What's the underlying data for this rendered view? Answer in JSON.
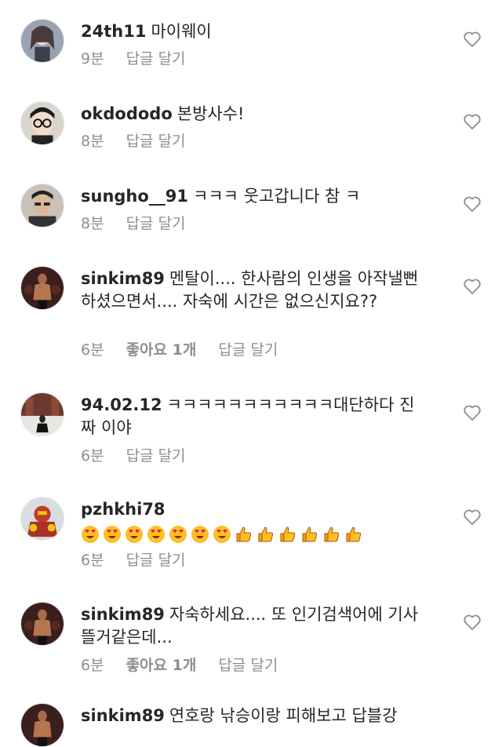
{
  "colors": {
    "text": "#262626",
    "meta": "#8e8e8e",
    "heart": "#8e8e8e"
  },
  "labels": {
    "reply": "답글 달기",
    "likes_prefix": "좋아요",
    "likes_suffix": "개"
  },
  "comments": [
    {
      "username": "24th11",
      "text": "마이웨이",
      "time": "9분",
      "likes": "",
      "avatar": "anime-girl-avatar"
    },
    {
      "username": "okdododo",
      "text": "본방사수!",
      "time": "8분",
      "likes": "",
      "avatar": "glasses-person-avatar"
    },
    {
      "username": "sungho__91",
      "text": "ㅋㅋㅋ 웃고갑니다 참 ㅋ",
      "time": "8분",
      "likes": "",
      "avatar": "man-avatar"
    },
    {
      "username": "sinkim89",
      "text": "멘탈이.... 한사람의 인생을 아작낼뻔하셨으면서.... 자숙에 시간은 없으신지요??",
      "time": "6분",
      "likes": "좋아요 1개",
      "avatar": "bodybuilder-avatar"
    },
    {
      "username": "94.02.12",
      "text": "ㅋㅋㅋㅋㅋㅋㅋㅋㅋㅋㅋ대단하다 진짜 이야",
      "time": "6분",
      "likes": "",
      "avatar": "winter-street-avatar"
    },
    {
      "username": "pzhkhi78",
      "text": "",
      "time": "6분",
      "likes": "",
      "avatar": "hulkbuster-avatar",
      "emojis": [
        "heart-eyes",
        "heart-eyes",
        "heart-eyes",
        "heart-eyes",
        "heart-eyes",
        "heart-eyes",
        "heart-eyes",
        "thumbs-up",
        "thumbs-up",
        "thumbs-up",
        "thumbs-up",
        "thumbs-up",
        "thumbs-up"
      ]
    },
    {
      "username": "sinkim89",
      "text": "자숙하세요.... 또 인기검색어에 기사뜰거같은데...",
      "time": "6분",
      "likes": "좋아요 1개",
      "avatar": "bodybuilder-avatar"
    },
    {
      "username": "sinkim89",
      "text": "연호랑 낚승이랑 피해보고 답블강",
      "time": "",
      "likes": "",
      "avatar": "bodybuilder-avatar"
    }
  ]
}
